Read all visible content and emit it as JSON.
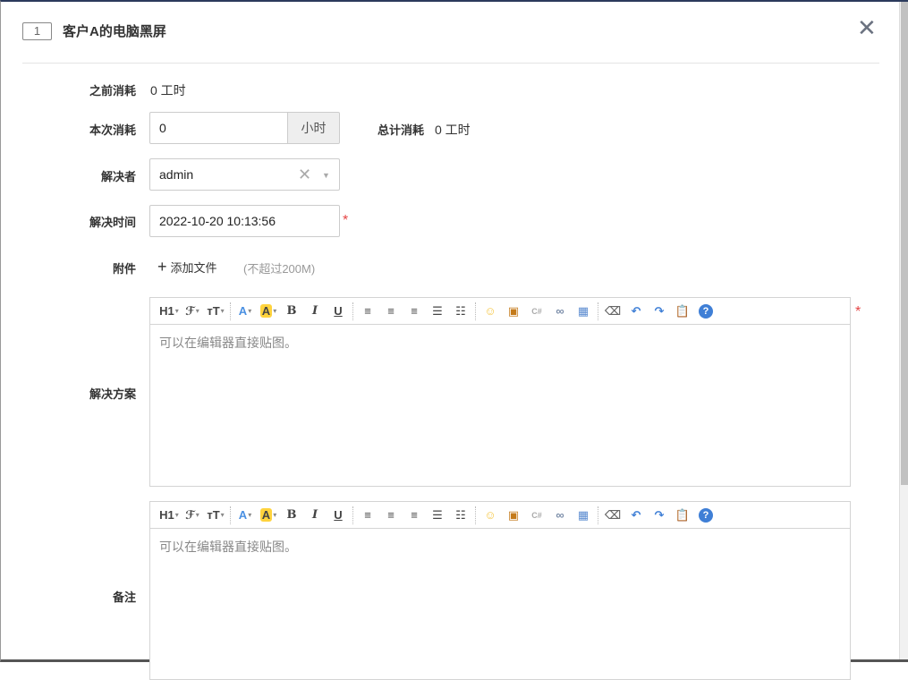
{
  "dialog": {
    "id": "1",
    "title": "客户A的电脑黑屏",
    "close_icon": "✕"
  },
  "fields": {
    "prev_cost_label": "之前消耗",
    "prev_cost_value": "0 工时",
    "this_cost_label": "本次消耗",
    "this_cost_value": "0",
    "this_cost_unit": "小时",
    "total_cost_label": "总计消耗",
    "total_cost_value": "0 工时",
    "resolver_label": "解决者",
    "resolver_value": "admin",
    "resolve_time_label": "解决时间",
    "resolve_time_value": "2022-10-20 10:13:56",
    "attachment_label": "附件",
    "add_file": "添加文件",
    "file_limit": "(不超过200M)",
    "solution_label": "解决方案",
    "remark_label": "备注",
    "editor_placeholder": "可以在编辑器直接贴图。",
    "required_mark": "*"
  },
  "toolbar": {
    "h1": "H1",
    "font": "ℱ",
    "size": "ᴛT",
    "color": "A",
    "bg": "A",
    "bold": "B",
    "italic": "I",
    "underline": "U"
  },
  "colors": {
    "accent": "#4a90e2",
    "required": "#e54545",
    "highlight": "#ffd33d"
  }
}
